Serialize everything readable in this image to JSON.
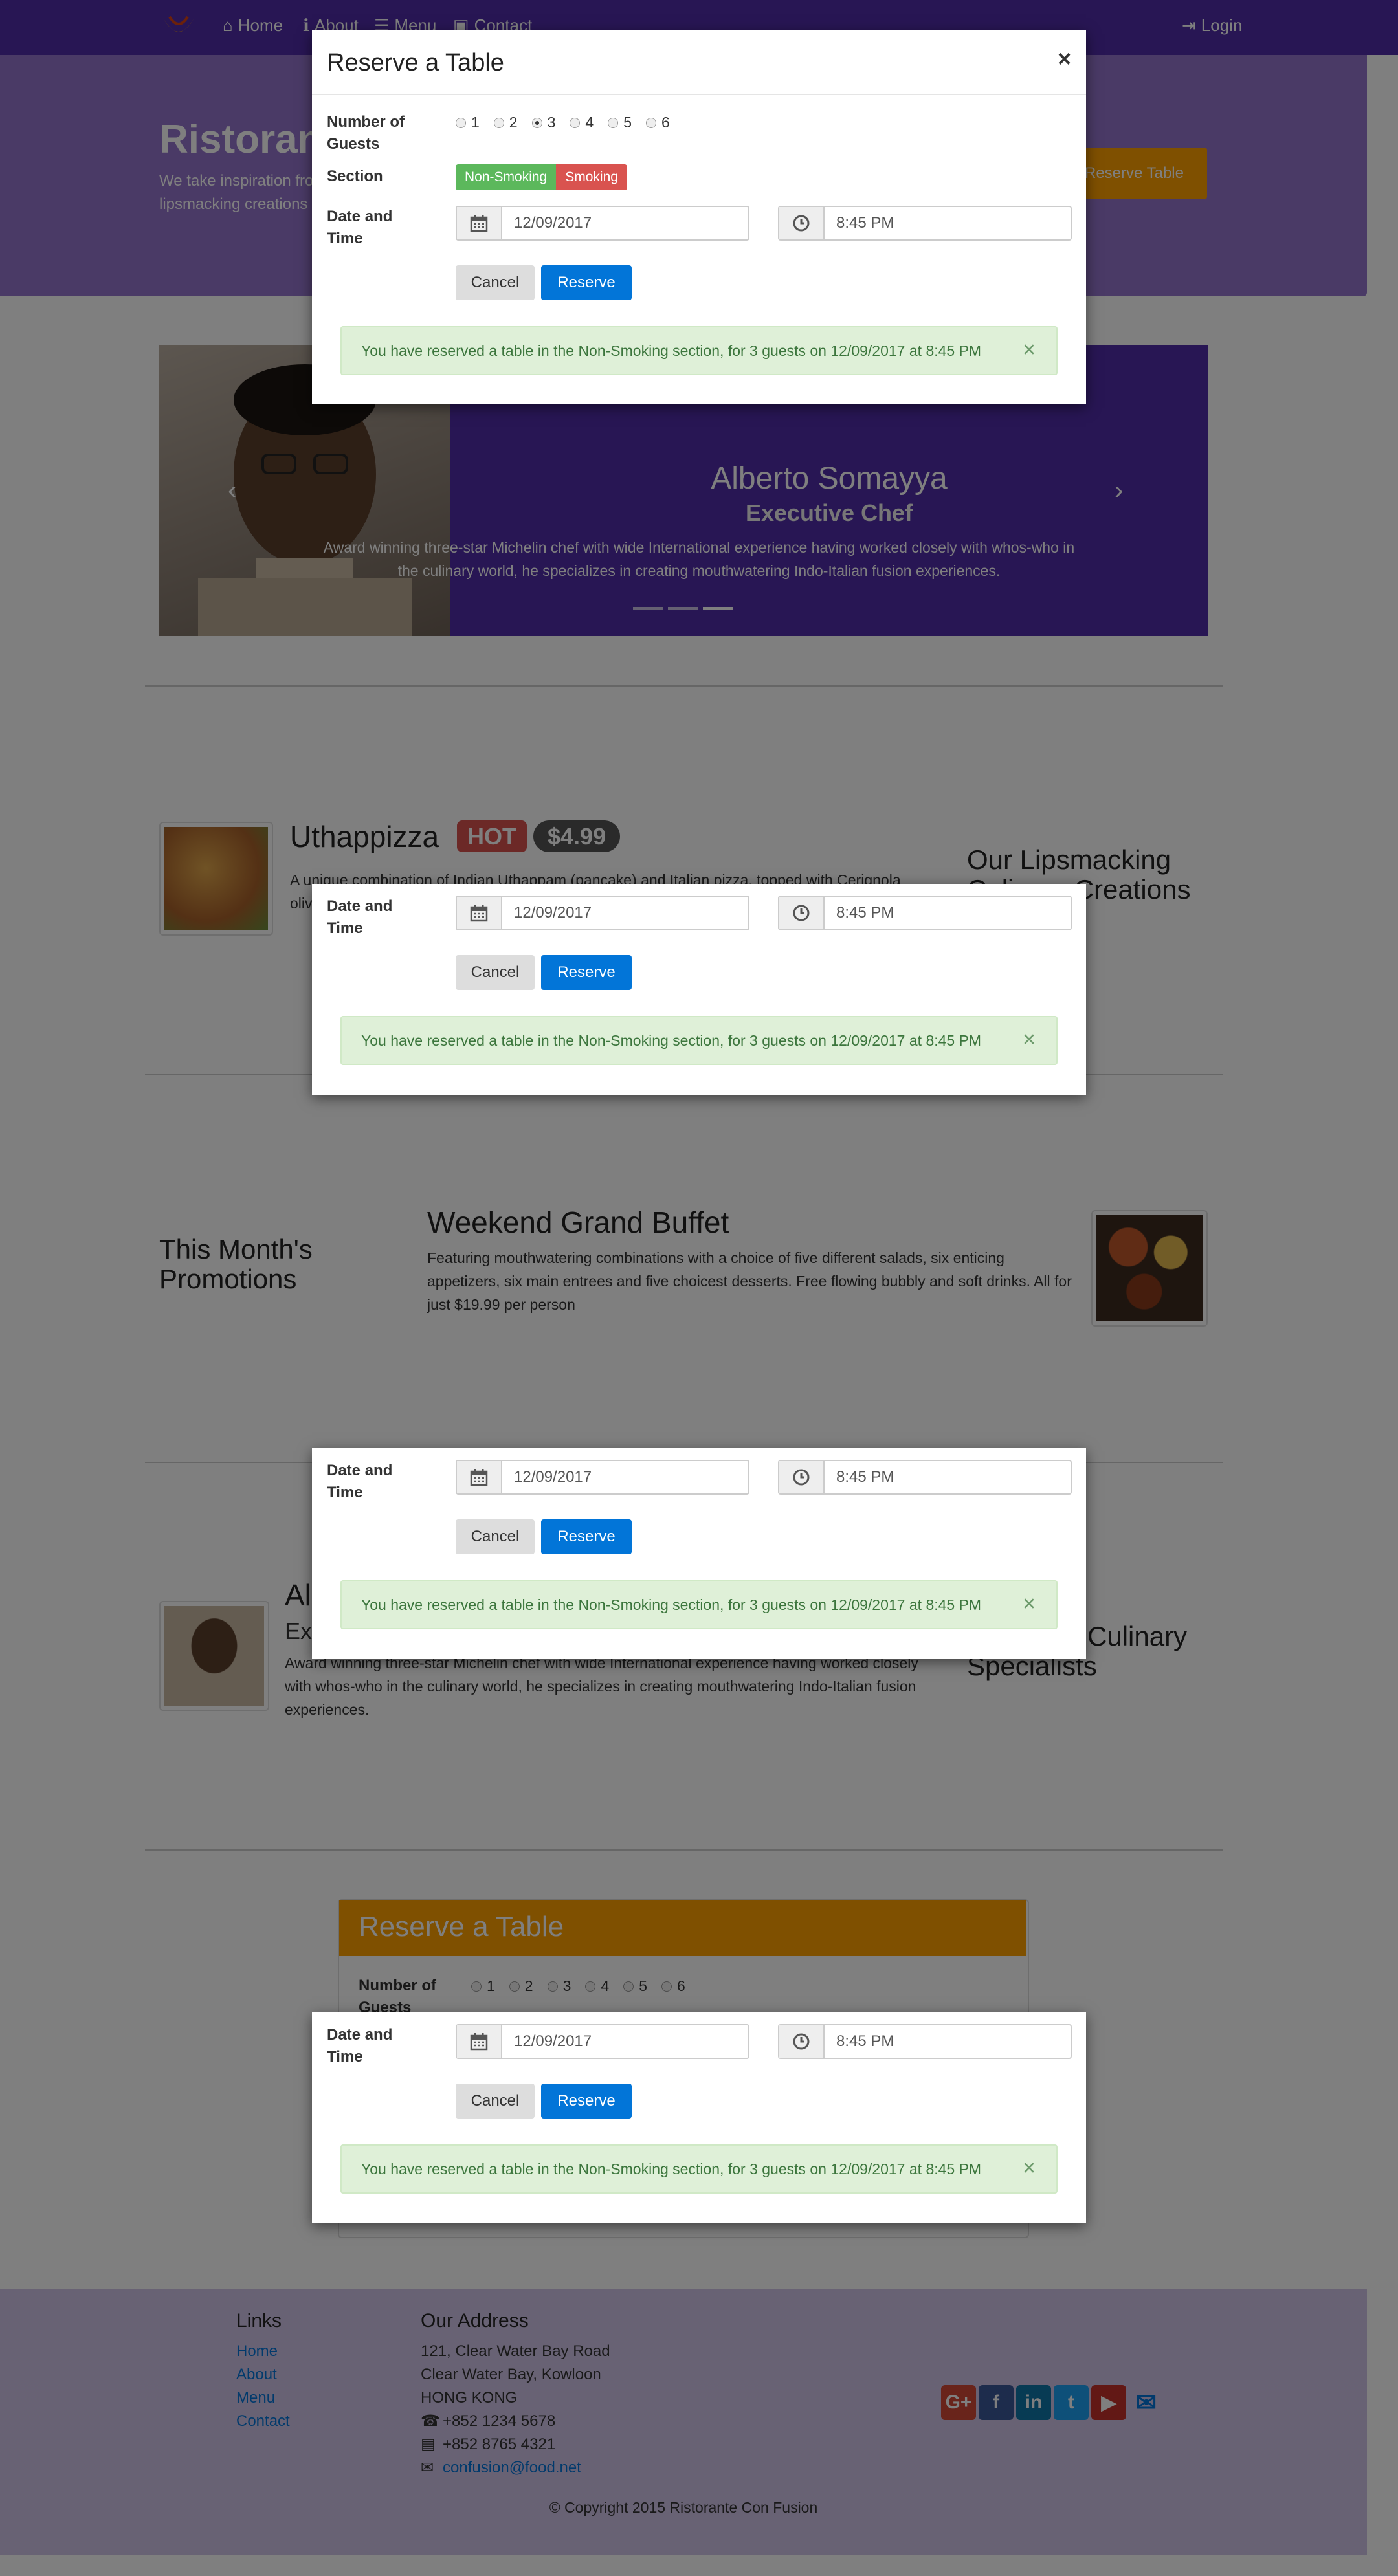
{
  "navbar": {
    "links": [
      "Home",
      "About",
      "Menu",
      "Contact"
    ],
    "login": "Login"
  },
  "jumbotron": {
    "title": "Ristorante",
    "text_line1": "We take inspiration from",
    "text_line2": "lipsmacking creations",
    "button": "Reserve Table"
  },
  "carousel": {
    "title": "Alberto Somayya",
    "subtitle": "Executive Chef",
    "text": "Award winning three-star Michelin chef with wide International experience having worked closely with whos-who in the culinary world, he specializes in creating mouthwatering Indo-Italian fusion experiences."
  },
  "dish": {
    "name": "Uthappizza",
    "label": "HOT",
    "price": "$4.99",
    "desc": "A unique combination of Indian Uthappam (pancake) and Italian pizza, topped with Cerignola",
    "desc_tail": "oliv",
    "side_heading": "Our Lipsmacking Culinary Creations"
  },
  "promo": {
    "side_heading": "This Month's Promotions",
    "name": "Weekend Grand Buffet",
    "desc": "Featuring mouthwatering combinations with a choice of five different salads, six enticing appetizers, six main entrees and five choicest desserts. Free flowing bubbly and soft drinks. All for just $19.99 per person"
  },
  "leader": {
    "name_part": "Al",
    "title_part": "Ex",
    "desc": "Award winning three-star Michelin chef with wide International experience having worked closely with whos-who in the culinary world, he specializes in creating mouthwatering Indo-Italian fusion experiences.",
    "side_heading": "Meet our Culinary Specialists",
    "side_visible_1": "Culinary",
    "side_visible_2": "Specialists"
  },
  "reserve_panel": {
    "title": "Reserve a Table",
    "guests_label": "Number of Guests",
    "guests_label_visible": "Number of",
    "guests_label_cut": "Guests"
  },
  "modal": {
    "title": "Reserve a Table",
    "close": "×",
    "guests_label": "Number of Guests",
    "guest_options": [
      "1",
      "2",
      "3",
      "4",
      "5",
      "6"
    ],
    "guests_selected": "3",
    "section_label": "Section",
    "section_options": [
      "Non-Smoking",
      "Smoking"
    ],
    "datetime_label": "Date and Time",
    "date_value": "12/09/2017",
    "time_value": "8:45 PM",
    "cancel": "Cancel",
    "reserve": "Reserve",
    "alert": "You have reserved a table in the Non-Smoking section, for 3 guests on 12/09/2017 at 8:45 PM",
    "alert_close": "×"
  },
  "footer": {
    "links_heading": "Links",
    "links": [
      "Home",
      "About",
      "Menu",
      "Contact"
    ],
    "address_heading": "Our Address",
    "address_lines": [
      "121, Clear Water Bay Road",
      "Clear Water Bay, Kowloon",
      "HONG KONG"
    ],
    "phone": "+852 1234 5678",
    "fax": "+852 8765 4321",
    "email": "confusion@food.net",
    "copyright": "© Copyright 2015 Ristorante Con Fusion",
    "social_icons": [
      "google-plus",
      "facebook",
      "linkedin",
      "twitter",
      "youtube",
      "mail"
    ]
  },
  "colors": {
    "primary": "#512DA8",
    "jumbotron": "#9575CD",
    "accent": "#FFA000",
    "footer": "#D1C4E9",
    "success_bg": "#dff0d8",
    "reserve_blue": "#0275d8"
  }
}
